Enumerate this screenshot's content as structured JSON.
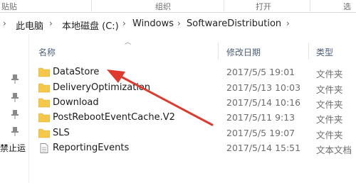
{
  "ribbon": {
    "paste_label": "贴贴",
    "organize_label": "组织",
    "open_label": "打开",
    "select_label": "选"
  },
  "address_bar": {
    "segments": [
      "此电脑",
      "本地磁盘 (C:)",
      "Windows",
      "SoftwareDistribution"
    ]
  },
  "nav_pane": {
    "label": "禁止运"
  },
  "columns": {
    "name": "名称",
    "date": "修改日期",
    "type": "类型"
  },
  "files": [
    {
      "name": "DataStore",
      "date": "2017/5/5 19:01",
      "type": "文件夹",
      "icon": "folder-icon"
    },
    {
      "name": "DeliveryOptimization",
      "date": "2017/5/13 10:03",
      "type": "文件夹",
      "icon": "folder-icon"
    },
    {
      "name": "Download",
      "date": "2017/5/14 10:16",
      "type": "文件夹",
      "icon": "folder-icon"
    },
    {
      "name": "PostRebootEventCache.V2",
      "date": "2017/5/11 9:13",
      "type": "文件夹",
      "icon": "folder-icon"
    },
    {
      "name": "SLS",
      "date": "2017/5/5 19:07",
      "type": "文件夹",
      "icon": "folder-icon"
    },
    {
      "name": "ReportingEvents",
      "date": "2017/5/14 15:51",
      "type": "文本文档",
      "icon": "text-file-icon"
    }
  ],
  "colors": {
    "folder": "#f5c84c",
    "annotation_arrow": "#e03a2f",
    "header_text": "#4c607a"
  }
}
